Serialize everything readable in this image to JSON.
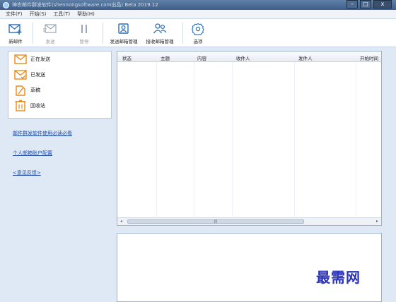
{
  "window": {
    "title": "神农邮件群发软件(shennongsoftware.com出品) Beta 2019.12",
    "buttons": {
      "minimize": "–",
      "maximize": "□",
      "close": "x"
    }
  },
  "menu": [
    "文件(F)",
    "开始(S)",
    "工具(T)",
    "帮助(H)"
  ],
  "toolbar": {
    "new_mail": "新邮件",
    "send": "发送",
    "pause": "暂停",
    "send_mailbox_manage": "发送邮箱管理",
    "receive_mailbox_manage": "接收邮箱管理",
    "options": "选项"
  },
  "sidebar": {
    "items": [
      {
        "label": "正在发送",
        "icon": "envelope-sending-icon"
      },
      {
        "label": "已发送",
        "icon": "envelope-sent-icon"
      },
      {
        "label": "草稿",
        "icon": "draft-icon"
      },
      {
        "label": "回收站",
        "icon": "trash-icon"
      }
    ],
    "links": [
      "邮件群发软件使用必读必看",
      "个人邮箱账户配置",
      "<意见反馈>"
    ]
  },
  "grid": {
    "columns": [
      "状态",
      "主题",
      "内容",
      "收件人",
      "发件人",
      "开始时间"
    ],
    "scroll_label": "|||"
  },
  "watermark": "最需网",
  "colors": {
    "accent": "#2b6fb8",
    "link": "#2350a6",
    "watermark": "#2a33b8",
    "mail_icon": "#e88a1a"
  }
}
